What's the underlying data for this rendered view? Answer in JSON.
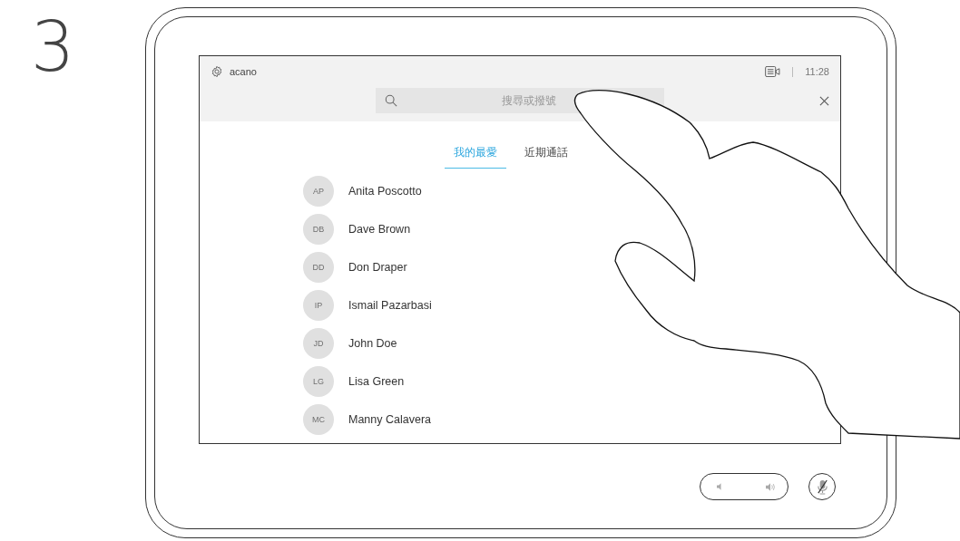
{
  "step": "3",
  "status_bar": {
    "name": "acano",
    "time": "11:28"
  },
  "search": {
    "placeholder": "搜尋或撥號"
  },
  "tabs": [
    {
      "label": "我的最愛",
      "selected": true
    },
    {
      "label": "近期通話",
      "selected": false
    }
  ],
  "contacts": [
    {
      "initials": "AP",
      "name": "Anita Poscotto"
    },
    {
      "initials": "DB",
      "name": "Dave Brown"
    },
    {
      "initials": "DD",
      "name": "Don Draper"
    },
    {
      "initials": "IP",
      "name": "Ismail Pazarbasi"
    },
    {
      "initials": "JD",
      "name": "John Doe"
    },
    {
      "initials": "LG",
      "name": "Lisa Green"
    },
    {
      "initials": "MC",
      "name": "Manny Calavera"
    }
  ],
  "controls": {
    "mic_muted": true
  }
}
